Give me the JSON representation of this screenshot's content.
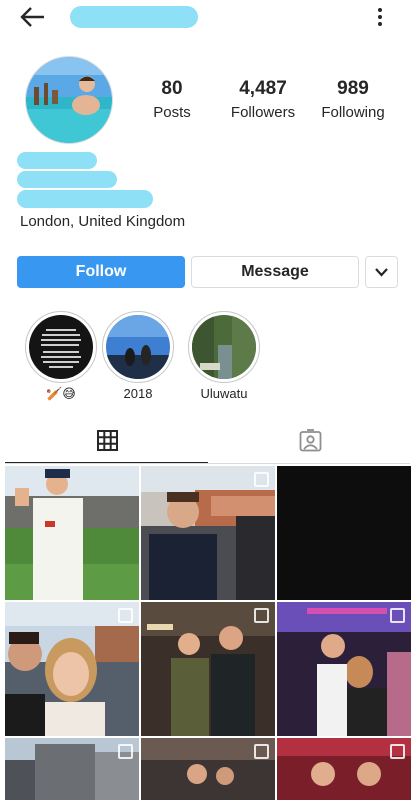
{
  "stats": {
    "posts": {
      "count": "80",
      "label": "Posts"
    },
    "followers": {
      "count": "4,487",
      "label": "Followers"
    },
    "following": {
      "count": "989",
      "label": "Following"
    }
  },
  "profile": {
    "location": "London, United Kingdom"
  },
  "actions": {
    "follow_label": "Follow",
    "message_label": "Message"
  },
  "highlights": [
    {
      "label": "🏏😅",
      "icon": "text-story"
    },
    {
      "label": "2018",
      "icon": "photo-sky"
    },
    {
      "label": "Uluwatu",
      "icon": "photo-cliffs"
    }
  ],
  "tabs": {
    "grid_icon": "grid-icon",
    "tagged_icon": "tagged-person-icon"
  },
  "colors": {
    "accent": "#3897f0",
    "redaction": "#8ee0f7",
    "border": "#dbdbdb",
    "text": "#262626"
  }
}
